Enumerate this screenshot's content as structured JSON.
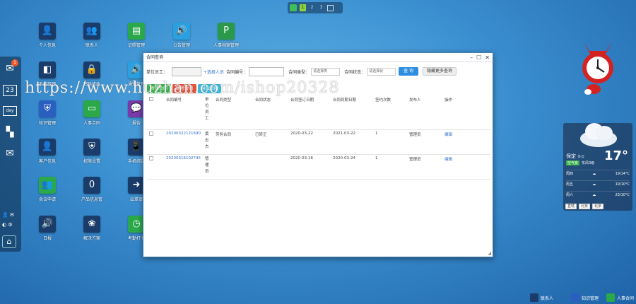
{
  "pager": {
    "pages": [
      "1",
      "2",
      "3"
    ],
    "active": "1"
  },
  "dock": {
    "mail_badge": "1",
    "calendar_day": "23",
    "day_label": "day"
  },
  "desktop_icons": [
    {
      "label": "个人信息"
    },
    {
      "label": "联系人"
    },
    {
      "label": "证照管理"
    },
    {
      "label": "公告管理"
    },
    {
      "label": "人事档案管理"
    },
    {
      "label": "系统管理"
    },
    {
      "label": "密码修改"
    },
    {
      "label": "通知管理"
    },
    {
      "label": "知识管理"
    },
    {
      "label": "人事合同"
    },
    {
      "label": "报告"
    },
    {
      "label": "客户信息"
    },
    {
      "label": "权限设置"
    },
    {
      "label": "手机绑定"
    },
    {
      "label": "会议申请"
    },
    {
      "label": "产品信息管"
    },
    {
      "label": "出差审"
    },
    {
      "label": "日报"
    },
    {
      "label": "解决方案"
    },
    {
      "label": "考勤打卡"
    }
  ],
  "watermark": "https://www.huzhan.com/ishop20328",
  "window": {
    "title": "合同查询",
    "toolbar": {
      "unit_staff_label": "单位员工：",
      "select_person_link": "+选择人员",
      "contract_no_label": "合同编号：",
      "contract_type_label": "合同类型：",
      "contract_type_value": "请选择类",
      "contract_status_label": "合同状态：",
      "contract_status_value": "请选择状",
      "query_btn": "查 询",
      "more_query_btn": "隐藏更多查询"
    },
    "actions": [
      "新增合同",
      "删除合同",
      "导出合同"
    ],
    "table": {
      "headers": [
        "",
        "合同编号",
        "单位员工",
        "合同类型",
        "合同状态",
        "合同签订日期",
        "合同到期日期",
        "签约次数",
        "发布人",
        "操作"
      ],
      "rows": [
        {
          "no": "20200322121690",
          "staff": "黄志杰",
          "type": "劳务合同",
          "status": "已转正",
          "signed": "2020-03-22",
          "expire": "2021-03-22",
          "times": "1",
          "publisher": "管理员",
          "op": "编辑"
        },
        {
          "no": "20200316102745",
          "staff": "管理员",
          "type": "",
          "status": "",
          "signed": "2020-03-16",
          "expire": "2020-03-24",
          "times": "1",
          "publisher": "管理员",
          "op": "编辑"
        }
      ]
    }
  },
  "weather": {
    "city": "保定",
    "desc": "多云",
    "temp": "17°",
    "air": "空气良",
    "wind": "东风3级",
    "forecast": [
      {
        "day": "周四",
        "temp": "19/14°C"
      },
      {
        "day": "周五",
        "temp": "19/10°C"
      },
      {
        "day": "周六",
        "temp": "23/10°C"
      }
    ],
    "selects": [
      "直辖",
      "北京",
      "北京"
    ]
  },
  "taskbar": [
    "联系人",
    "知识管理",
    "人事合同"
  ],
  "colors": {
    "link": "#2d6fc6",
    "primary_button": "#2e8ee0",
    "add": "#36b04a",
    "delete": "#e0543c",
    "export": "#3bb7d8"
  }
}
